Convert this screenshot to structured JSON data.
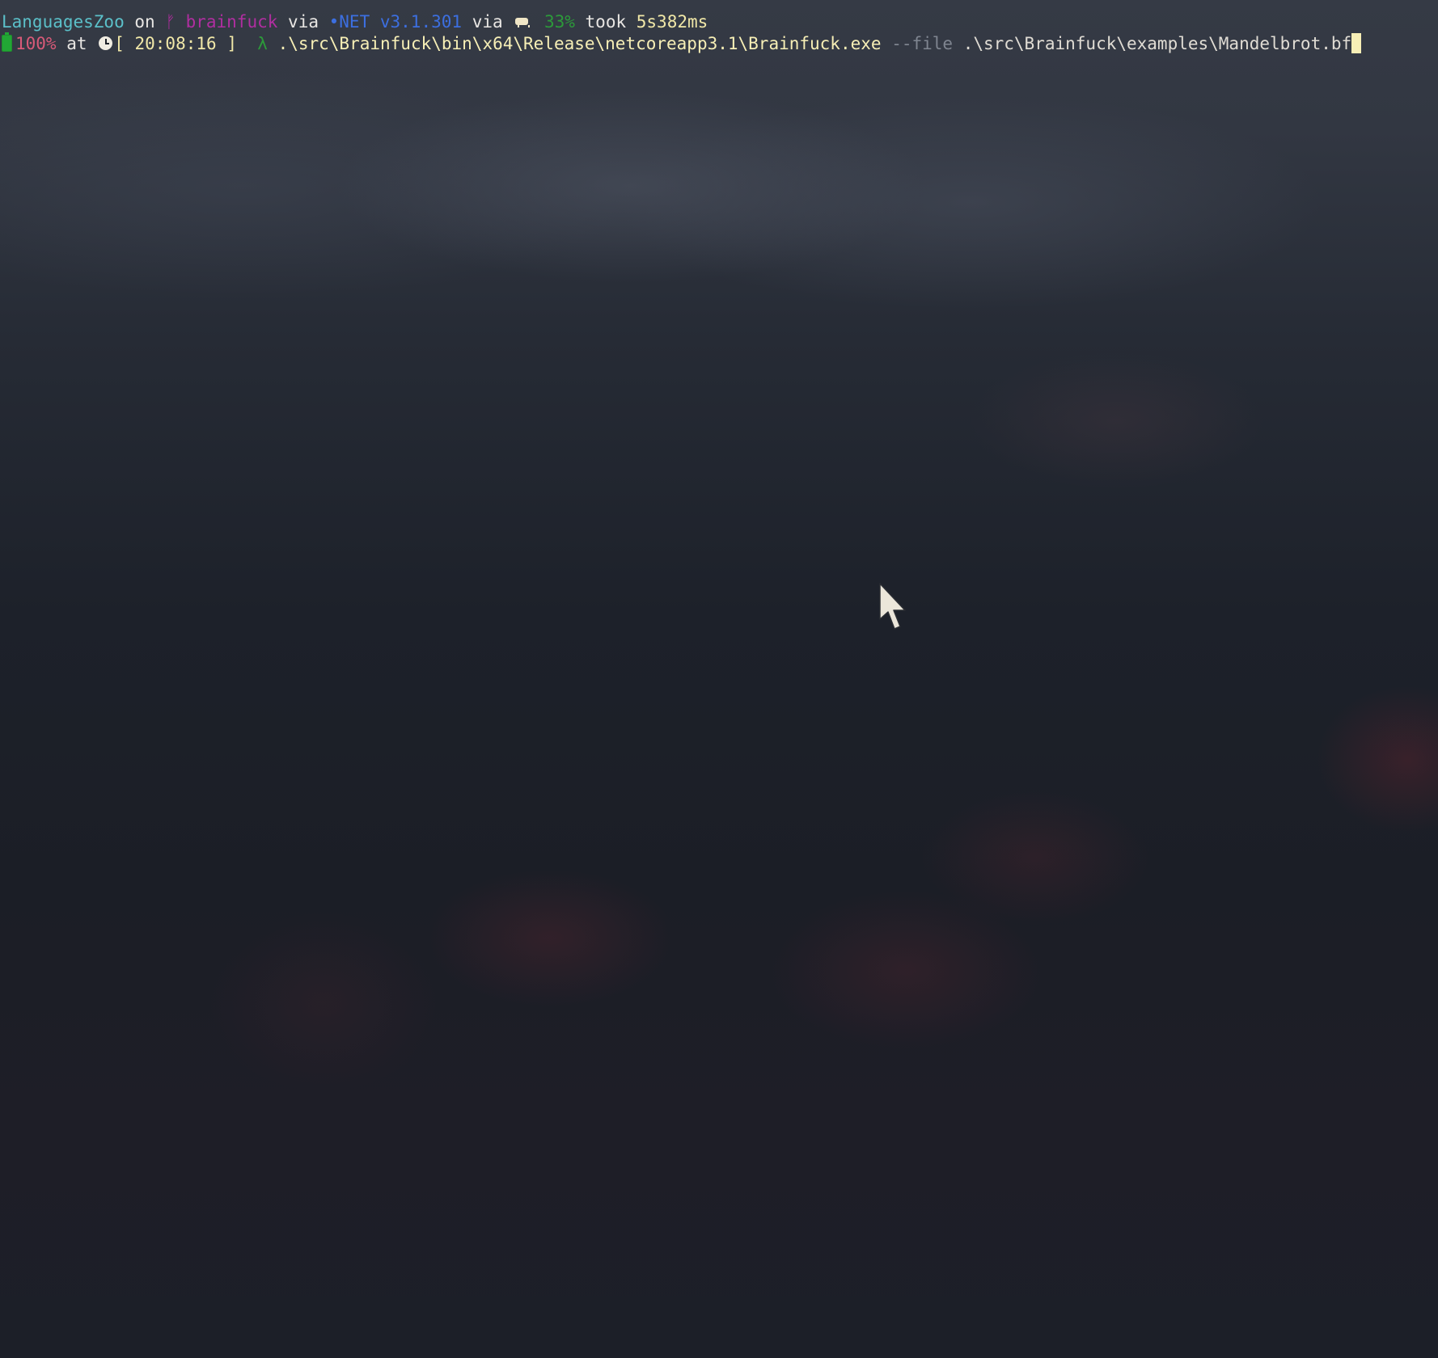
{
  "prompt": {
    "directory": "LanguagesZoo",
    "on_word": "on",
    "branch_icon": "git-branch-icon",
    "branch": "brainfuck",
    "via_word_1": "via",
    "dotnet_label": "•NET",
    "dotnet_version": "v3.1.301",
    "via_word_2": "via",
    "memory_icon": "ram-icon",
    "memory_usage": "33%",
    "took_word": "took",
    "duration": "5s382ms",
    "battery_icon": "battery-icon",
    "battery": "100%",
    "at_word": "at",
    "clock_icon": "clock-icon",
    "time_bracket_open": "[",
    "time": "20:08:16",
    "time_bracket_close": "]",
    "lambda": "λ"
  },
  "command": {
    "executable": ".\\src\\Brainfuck\\bin\\x64\\Release\\netcoreapp3.1\\Brainfuck.exe",
    "flag": "--file",
    "argument": ".\\src\\Brainfuck\\examples\\Mandelbrot.bf"
  },
  "colors": {
    "directory": "#5bc0c9",
    "branch": "#b02ea0",
    "dotnet": "#3c6fe0",
    "memory": "#2c9a3a",
    "battery": "#d85a78",
    "command": "#f7efb6",
    "flag": "#7f8590"
  }
}
